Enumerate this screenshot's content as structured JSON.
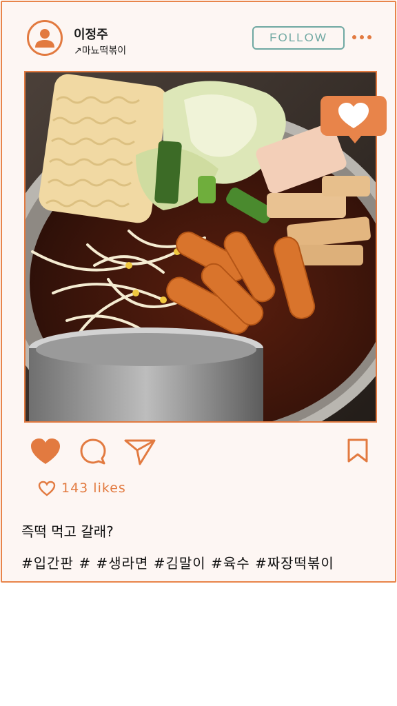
{
  "post": {
    "username": "이정주",
    "location": "↗마뇨떡볶이",
    "follow_label": "FOLLOW",
    "likes": "143 likes",
    "caption": "즉떡 먹고 갈래?",
    "hashtags": "#입간판 # #생라면 #김말이 #육수 #짜장떡볶이"
  },
  "icons": {
    "avatar": "user-icon",
    "more": "more-options-icon",
    "overlay": "heart-badge-icon",
    "like": "heart-filled-icon",
    "comment": "comment-icon",
    "share": "send-icon",
    "save": "bookmark-icon",
    "likes_count": "heart-outline-icon"
  },
  "colors": {
    "accent": "#e27a40",
    "follow": "#6fa8a2",
    "card_bg": "#fdf6f3"
  }
}
